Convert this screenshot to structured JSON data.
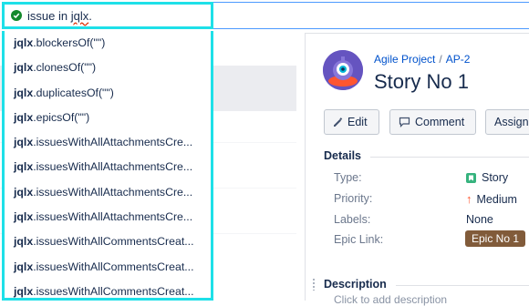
{
  "query": {
    "prefix": "issue in ",
    "error_word": "jqlx",
    "suffix": "."
  },
  "suggestions": [
    {
      "ns": "jqlx",
      "fn": ".blockersOf(\"\")"
    },
    {
      "ns": "jqlx",
      "fn": ".clonesOf(\"\")"
    },
    {
      "ns": "jqlx",
      "fn": ".duplicatesOf(\"\")"
    },
    {
      "ns": "jqlx",
      "fn": ".epicsOf(\"\")"
    },
    {
      "ns": "jqlx",
      "fn": ".issuesWithAllAttachmentsCre..."
    },
    {
      "ns": "jqlx",
      "fn": ".issuesWithAllAttachmentsCre..."
    },
    {
      "ns": "jqlx",
      "fn": ".issuesWithAllAttachmentsCre..."
    },
    {
      "ns": "jqlx",
      "fn": ".issuesWithAllAttachmentsCre..."
    },
    {
      "ns": "jqlx",
      "fn": ".issuesWithAllCommentsCreat..."
    },
    {
      "ns": "jqlx",
      "fn": ".issuesWithAllCommentsCreat..."
    },
    {
      "ns": "jqlx",
      "fn": ".issuesWithAllCommentsCreat..."
    }
  ],
  "issue": {
    "project": "Agile Project",
    "separator": "/",
    "key": "AP-2",
    "title": "Story No 1"
  },
  "actions": {
    "edit": "Edit",
    "comment": "Comment",
    "assign": "Assign"
  },
  "details": {
    "heading": "Details",
    "type_label": "Type:",
    "type_value": "Story",
    "priority_label": "Priority:",
    "priority_value": "Medium",
    "labels_label": "Labels:",
    "labels_value": "None",
    "epic_label": "Epic Link:",
    "epic_value": "Epic No 1"
  },
  "description": {
    "heading": "Description",
    "placeholder": "Click to add description"
  },
  "colors": {
    "focus_outline": "#1ee0e8",
    "link": "#0052cc",
    "valid": "#14892c",
    "epic": "#815b3a",
    "story": "#36b37e",
    "priority_medium": "#ff5630"
  },
  "icons": [
    "check-circle-icon",
    "project-avatar-icon",
    "pencil-icon",
    "comment-icon",
    "story-icon",
    "priority-medium-icon"
  ]
}
